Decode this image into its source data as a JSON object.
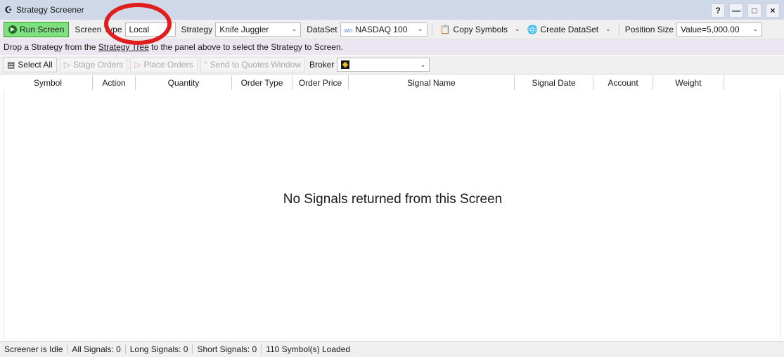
{
  "window": {
    "title": "Strategy Screener",
    "app_icon": "strategy-icon",
    "buttons": [
      "?",
      "—",
      "□",
      "×"
    ]
  },
  "toolbar": {
    "run_label": "Run Screen",
    "screen_type_label": "Screen Type",
    "screen_type_value": "Local",
    "strategy_label": "Strategy",
    "strategy_value": "Knife Juggler",
    "dataset_label": "DataSet",
    "dataset_badge": "WD",
    "dataset_value": "NASDAQ 100",
    "copy_symbols_label": "Copy Symbols",
    "create_dataset_label": "Create DataSet",
    "position_size_label": "Position Size",
    "position_size_value": "Value=5,000.00"
  },
  "info": {
    "prefix": "Drop a Strategy from the ",
    "link": "Strategy Tree",
    "suffix": " to the panel above to select the Strategy to Screen."
  },
  "toolbar2": {
    "select_all": "Select All",
    "stage_orders": "Stage Orders",
    "place_orders": "Place Orders",
    "send_quotes": "Send to Quotes Window",
    "broker_label": "Broker"
  },
  "grid": {
    "columns": [
      "Symbol",
      "Action",
      "Quantity",
      "Order Type",
      "Order Price",
      "Signal Name",
      "Signal Date",
      "Account",
      "Weight"
    ],
    "empty_message": "No Signals returned from this Screen"
  },
  "status": {
    "state": "Screener is Idle",
    "all_signals": "All Signals: 0",
    "long_signals": "Long Signals: 0",
    "short_signals": "Short Signals: 0",
    "symbols_loaded": "110 Symbol(s) Loaded"
  },
  "colors": {
    "run_button": "#7ee07e",
    "annotation_circle": "#e01e1e",
    "info_bar": "#ece6f2"
  }
}
